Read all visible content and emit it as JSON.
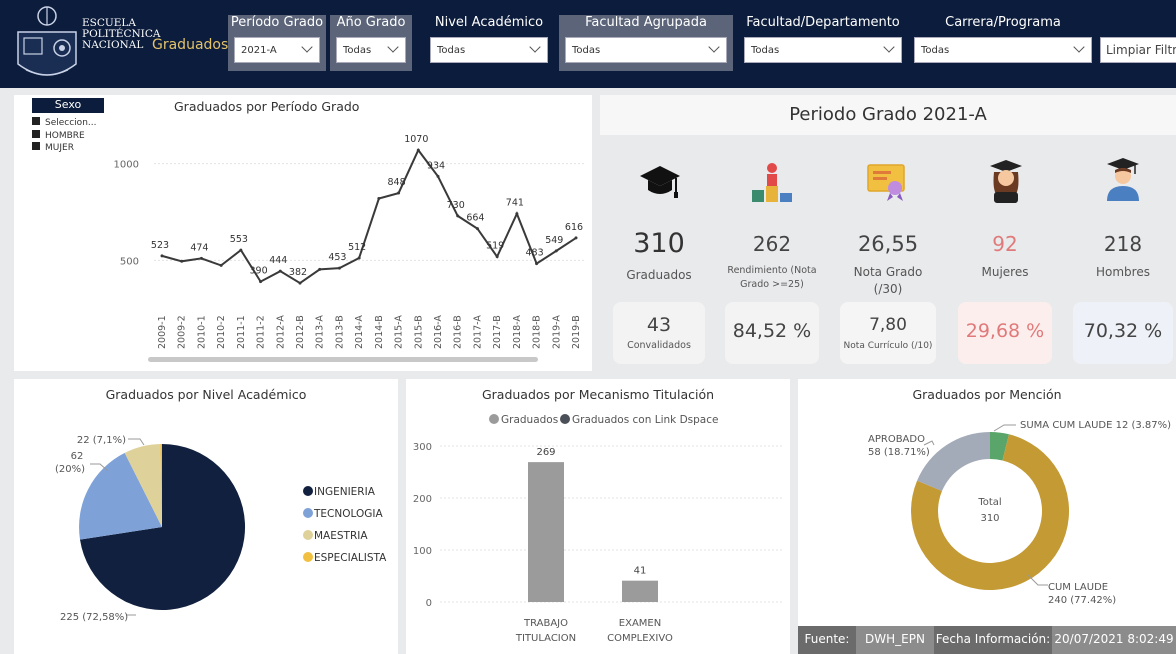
{
  "header": {
    "logo_lines": [
      "ESCUELA",
      "POLITÉCNICA",
      "NACIONAL"
    ],
    "app_title": "Graduados",
    "filters": [
      {
        "label": "Período Grado",
        "value": "2021-A"
      },
      {
        "label": "Año Grado",
        "value": "Todas"
      },
      {
        "label": "Nivel Académico",
        "value": "Todas"
      },
      {
        "label": "Facultad Agrupada",
        "value": "Todas"
      },
      {
        "label": "Facultad/Departamento",
        "value": "Todas"
      },
      {
        "label": "Carrera/Programa",
        "value": "Todas"
      }
    ],
    "clear_button": "Limpiar Filtros"
  },
  "sexo_slicer": {
    "title": "Sexo",
    "items": [
      "Seleccion...",
      "HOMBRE",
      "MUJER"
    ]
  },
  "line_chart": {
    "card_title": "Graduados por Período Grado",
    "chart_data": {
      "type": "line",
      "x": [
        "2009-1",
        "2009-2",
        "2010-1",
        "2010-2",
        "2011-1",
        "2011-2",
        "2012-A",
        "2012-B",
        "2013-A",
        "2013-B",
        "2014-A",
        "2014-B",
        "2015-A",
        "2015-B",
        "2016-A",
        "2016-B",
        "2017-A",
        "2017-B",
        "2018-A",
        "2018-B",
        "2019-A",
        "2019-B"
      ],
      "values": [
        523,
        495,
        510,
        474,
        553,
        390,
        444,
        382,
        453,
        460,
        512,
        820,
        848,
        1070,
        934,
        730,
        664,
        519,
        741,
        483,
        549,
        616
      ],
      "labels": [
        "523",
        "",
        "474",
        "",
        "553",
        "390",
        "444",
        "382",
        "",
        "453",
        "512",
        "",
        "848",
        "1070",
        "934",
        "730",
        "664",
        "519",
        "741",
        "483",
        "549",
        "616"
      ],
      "yticks": [
        "500",
        "1000"
      ],
      "ylim": [
        300,
        1200
      ],
      "color": "#3a3a3a"
    }
  },
  "kpi": {
    "period_title": "Periodo Grado 2021-A",
    "cards": [
      {
        "value": "310",
        "label": "Graduados",
        "inner_value": "43",
        "inner_label": "Convalidados",
        "bg": "#d7d4d3",
        "value_color": "#444",
        "icon": "graduation-cap-icon"
      },
      {
        "value": "262",
        "label": "Rendimiento (Nota Grado >=25)",
        "inner_value": "84,52 %",
        "inner_label": "",
        "bg": "#c3d9c3",
        "value_color": "#444",
        "icon": "podium-icon"
      },
      {
        "value": "26,55",
        "label": "Nota Grado (/30)",
        "inner_value": "7,80",
        "inner_label": "Nota Currículo (/10)",
        "bg": "#dccfe2",
        "value_color": "#444",
        "icon": "certificate-icon"
      },
      {
        "value": "92",
        "label": "Mujeres",
        "inner_value": "29,68 %",
        "inner_label": "",
        "bg": "#f2caca",
        "value_color": "#e07a7a",
        "icon": "female-graduate-icon"
      },
      {
        "value": "218",
        "label": "Hombres",
        "inner_value": "70,32 %",
        "inner_label": "",
        "bg": "#d5dbe9",
        "value_color": "#444",
        "icon": "male-graduate-icon"
      }
    ]
  },
  "pie_chart": {
    "card_title": "Graduados por Nivel Académico",
    "chart_data": {
      "type": "pie",
      "categories": [
        "INGENIERIA",
        "TECNOLOGIA",
        "MAESTRIA",
        "ESPECIALISTA"
      ],
      "values": [
        225,
        62,
        22,
        1
      ],
      "colors": [
        "#12203f",
        "#7ea2d8",
        "#dfd19a",
        "#f2c041"
      ],
      "labels": [
        "225 (72,58%)",
        "62 (20%)",
        "22 (7,1%)",
        ""
      ]
    },
    "label_62_lines": [
      "62",
      "(20%)"
    ]
  },
  "bar_chart": {
    "card_title": "Graduados por Mecanismo Titulación",
    "chart_data": {
      "type": "bar",
      "categories": [
        [
          "TRABAJO",
          "TITULACION"
        ],
        [
          "EXAMEN",
          "COMPLEXIVO"
        ]
      ],
      "series": [
        {
          "name": "Graduados",
          "values": [
            269,
            41
          ],
          "color": "#9b9b9b"
        },
        {
          "name": "Graduados con Link Dspace",
          "values": [
            0,
            0
          ],
          "color": "#4b4f57"
        }
      ],
      "yticks": [
        "0",
        "100",
        "200",
        "300"
      ],
      "ylim": [
        0,
        300
      ],
      "data_labels": [
        "269",
        "41"
      ]
    }
  },
  "donut_chart": {
    "card_title": "Graduados por Mención",
    "chart_data": {
      "type": "pie",
      "categories": [
        "SUMA CUM LAUDE",
        "CUM LAUDE",
        "APROBADO"
      ],
      "values": [
        12,
        240,
        58
      ],
      "colors": [
        "#5aa56a",
        "#c49a34",
        "#a3abb8"
      ],
      "labels": [
        "SUMA CUM LAUDE 12 (3.87%)",
        "CUM LAUDE",
        "240 (77.42%)",
        "APROBADO",
        "58 (18.71%)"
      ]
    },
    "center_label": "Total",
    "center_value": "310"
  },
  "footer": {
    "source_label": "Fuente:",
    "source_value": "DWH_EPN",
    "date_label": "Fecha Información:",
    "date_value": "20/07/2021 8:02:49"
  }
}
